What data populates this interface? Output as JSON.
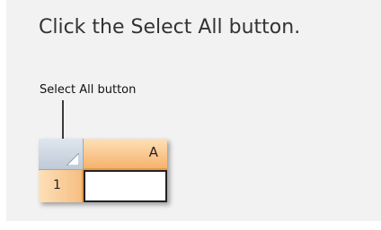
{
  "instruction": "Click the Select All button.",
  "callout": {
    "label": "Select All button"
  },
  "grid": {
    "column_header": "A",
    "row_header": "1",
    "cell_value": ""
  },
  "colors": {
    "header_orange": "#f6b26b",
    "select_all_blue": "#bfcad7"
  }
}
